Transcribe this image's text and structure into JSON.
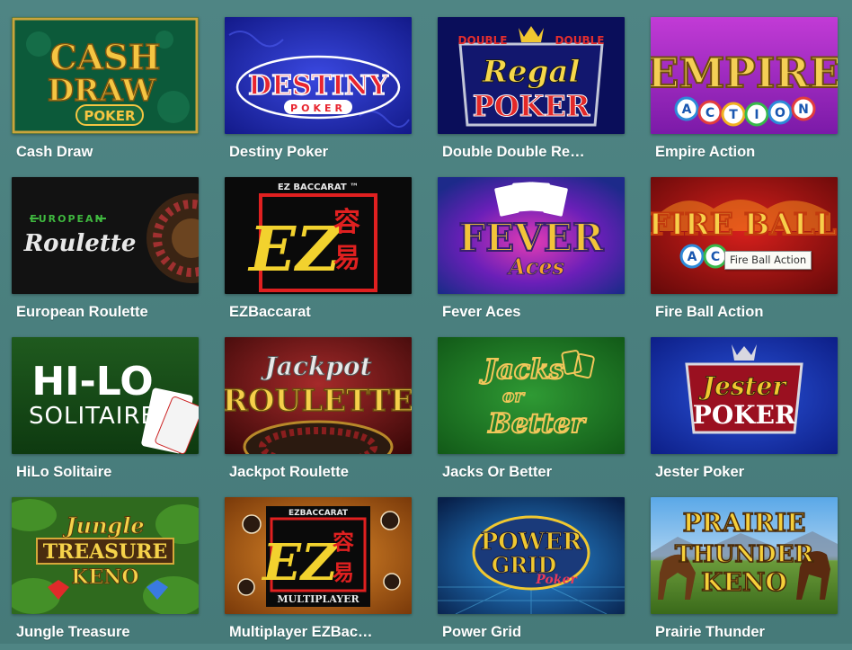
{
  "games": [
    {
      "id": "cash-draw",
      "title": "Cash Draw",
      "art": [
        "CASH",
        "DRAW",
        "POKER"
      ],
      "icon": "cash-draw-poker-logo"
    },
    {
      "id": "destiny-poker",
      "title": "Destiny Poker",
      "art": [
        "DESTINY",
        "POKER"
      ],
      "icon": "destiny-poker-logo"
    },
    {
      "id": "double-double-regal-poker",
      "title": "Double Double Re…",
      "art": [
        "DOUBLE",
        "DOUBLE",
        "Regal",
        "POKER"
      ],
      "icon": "regal-poker-logo"
    },
    {
      "id": "empire-action",
      "title": "Empire Action",
      "art": [
        "EMPIRE",
        "A",
        "C",
        "T",
        "I",
        "O",
        "N"
      ],
      "icon": "empire-action-logo"
    },
    {
      "id": "european-roulette",
      "title": "European Roulette",
      "art": [
        "EUROPEAN",
        "Roulette"
      ],
      "icon": "roulette-wheel-icon"
    },
    {
      "id": "ezbaccarat",
      "title": "EZBaccarat",
      "art": [
        "EZ BACCARAT ™",
        "EZ",
        "容",
        "易"
      ],
      "icon": "ez-baccarat-logo"
    },
    {
      "id": "fever-aces",
      "title": "Fever Aces",
      "art": [
        "FEVER",
        "Aces"
      ],
      "icon": "fever-aces-logo"
    },
    {
      "id": "fire-ball-action",
      "title": "Fire Ball Action",
      "art": [
        "FIRE BALL",
        "A",
        "C"
      ],
      "icon": "fire-ball-logo"
    },
    {
      "id": "hilo-solitaire",
      "title": "HiLo Solitaire",
      "art": [
        "HI-LO",
        "SOLITAIRE"
      ],
      "icon": "playing-cards-icon"
    },
    {
      "id": "jackpot-roulette",
      "title": "Jackpot Roulette",
      "art": [
        "Jackpot",
        "ROULETTE"
      ],
      "icon": "jackpot-roulette-logo"
    },
    {
      "id": "jacks-or-better",
      "title": "Jacks Or Better",
      "art": [
        "Jacks",
        "or",
        "Better"
      ],
      "icon": "jacks-or-better-logo"
    },
    {
      "id": "jester-poker",
      "title": "Jester Poker",
      "art": [
        "Jester",
        "POKER"
      ],
      "icon": "jester-poker-logo"
    },
    {
      "id": "jungle-treasure",
      "title": "Jungle Treasure",
      "art": [
        "Jungle",
        "TREASURE",
        "KENO"
      ],
      "icon": "jungle-treasure-logo"
    },
    {
      "id": "multiplayer-ezbaccarat",
      "title": "Multiplayer EZBac…",
      "art": [
        "EZBACCARAT",
        "EZ",
        "容",
        "易",
        "MULTIPLAYER"
      ],
      "icon": "ez-baccarat-multiplayer-logo"
    },
    {
      "id": "power-grid",
      "title": "Power Grid",
      "art": [
        "POWER",
        "GRID",
        "Poker"
      ],
      "icon": "power-grid-logo"
    },
    {
      "id": "prairie-thunder",
      "title": "Prairie Thunder",
      "art": [
        "PRAIRIE",
        "THUNDER",
        "KENO"
      ],
      "icon": "prairie-thunder-logo"
    }
  ],
  "tooltip": {
    "text": "Fire Ball Action"
  },
  "colors": {
    "background": "#4c8281",
    "title_text": "#ffffff",
    "tooltip_bg": "#fbfbf6"
  }
}
